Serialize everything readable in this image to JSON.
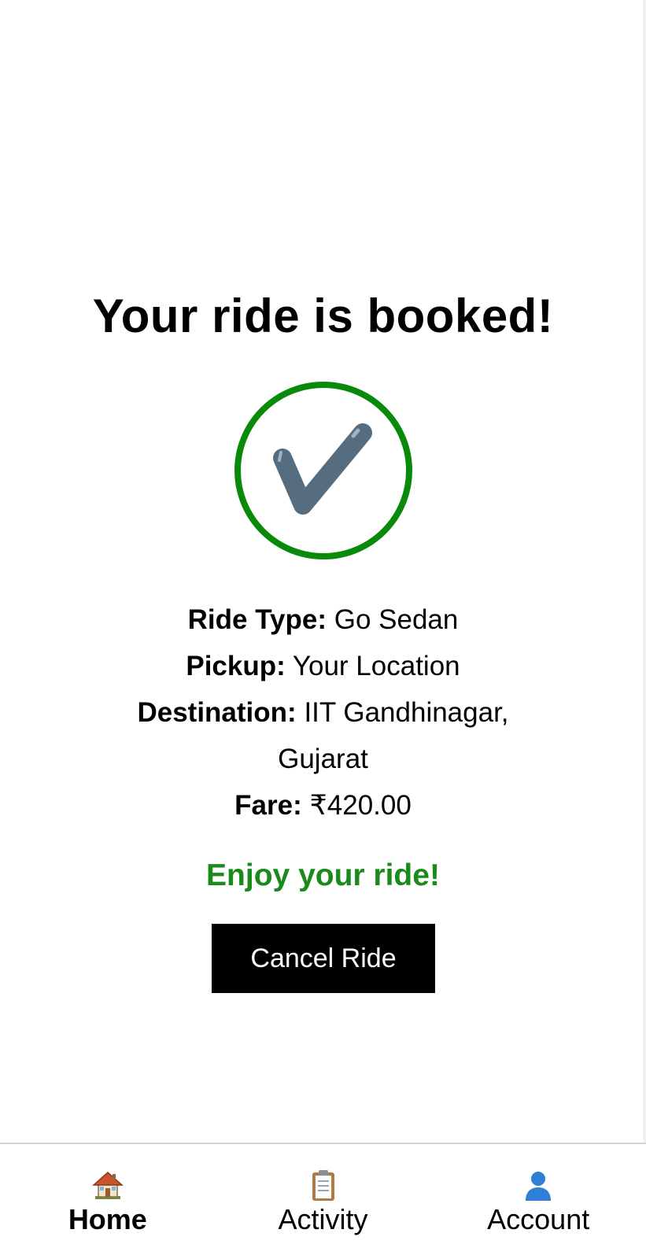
{
  "confirmation": {
    "title": "Your ride is booked!",
    "check_icon": "check-mark-icon",
    "ring_color": "#0a8a0a",
    "check_color": "#566d80"
  },
  "details": {
    "ride_type": {
      "label": "Ride Type:",
      "value": "Go Sedan"
    },
    "pickup": {
      "label": "Pickup:",
      "value": "Your Location"
    },
    "destination": {
      "label": "Destination:",
      "value_line1": "IIT Gandhinagar,",
      "value_line2": "Gujarat"
    },
    "fare": {
      "label": "Fare:",
      "value": "₹420.00"
    }
  },
  "message": {
    "text": "Enjoy your ride!",
    "color": "#1a8a1a"
  },
  "actions": {
    "cancel_label": "Cancel Ride"
  },
  "bottom_nav": {
    "items": [
      {
        "label": "Home",
        "icon": "home-icon",
        "active": true
      },
      {
        "label": "Activity",
        "icon": "clipboard-icon",
        "active": false
      },
      {
        "label": "Account",
        "icon": "user-icon",
        "active": false
      }
    ]
  }
}
